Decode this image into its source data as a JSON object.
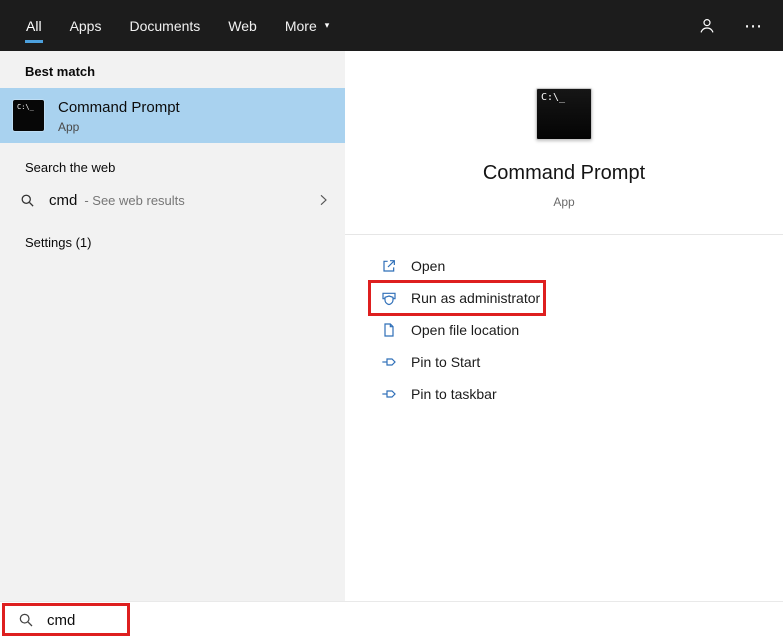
{
  "colors": {
    "topbar_bg": "#1c1c1c",
    "accent_underline": "#4ca0dd",
    "selection_blue": "#a9d2ef",
    "highlight_red": "#de1f1f",
    "action_icon_blue": "#2f6fb8",
    "left_panel_bg": "#f2f2f2"
  },
  "topbar": {
    "tabs": [
      {
        "label": "All"
      },
      {
        "label": "Apps"
      },
      {
        "label": "Documents"
      },
      {
        "label": "Web"
      },
      {
        "label": "More"
      }
    ],
    "more_caret": "▾",
    "ellipsis_icon": "⋯"
  },
  "left_panel": {
    "best_match_header": "Best match",
    "best_match": {
      "title": "Command Prompt",
      "subtitle": "App"
    },
    "web_header": "Search the web",
    "web_result": {
      "query": "cmd",
      "hint": "- See web results"
    },
    "settings_header": "Settings (1)"
  },
  "preview": {
    "title": "Command Prompt",
    "subtitle": "App",
    "actions": [
      {
        "label": "Open"
      },
      {
        "label": "Run as administrator"
      },
      {
        "label": "Open file location"
      },
      {
        "label": "Pin to Start"
      },
      {
        "label": "Pin to taskbar"
      }
    ]
  },
  "search_bar": {
    "value": "cmd"
  },
  "icons": {
    "cmd_glyph": "C:\\_"
  }
}
